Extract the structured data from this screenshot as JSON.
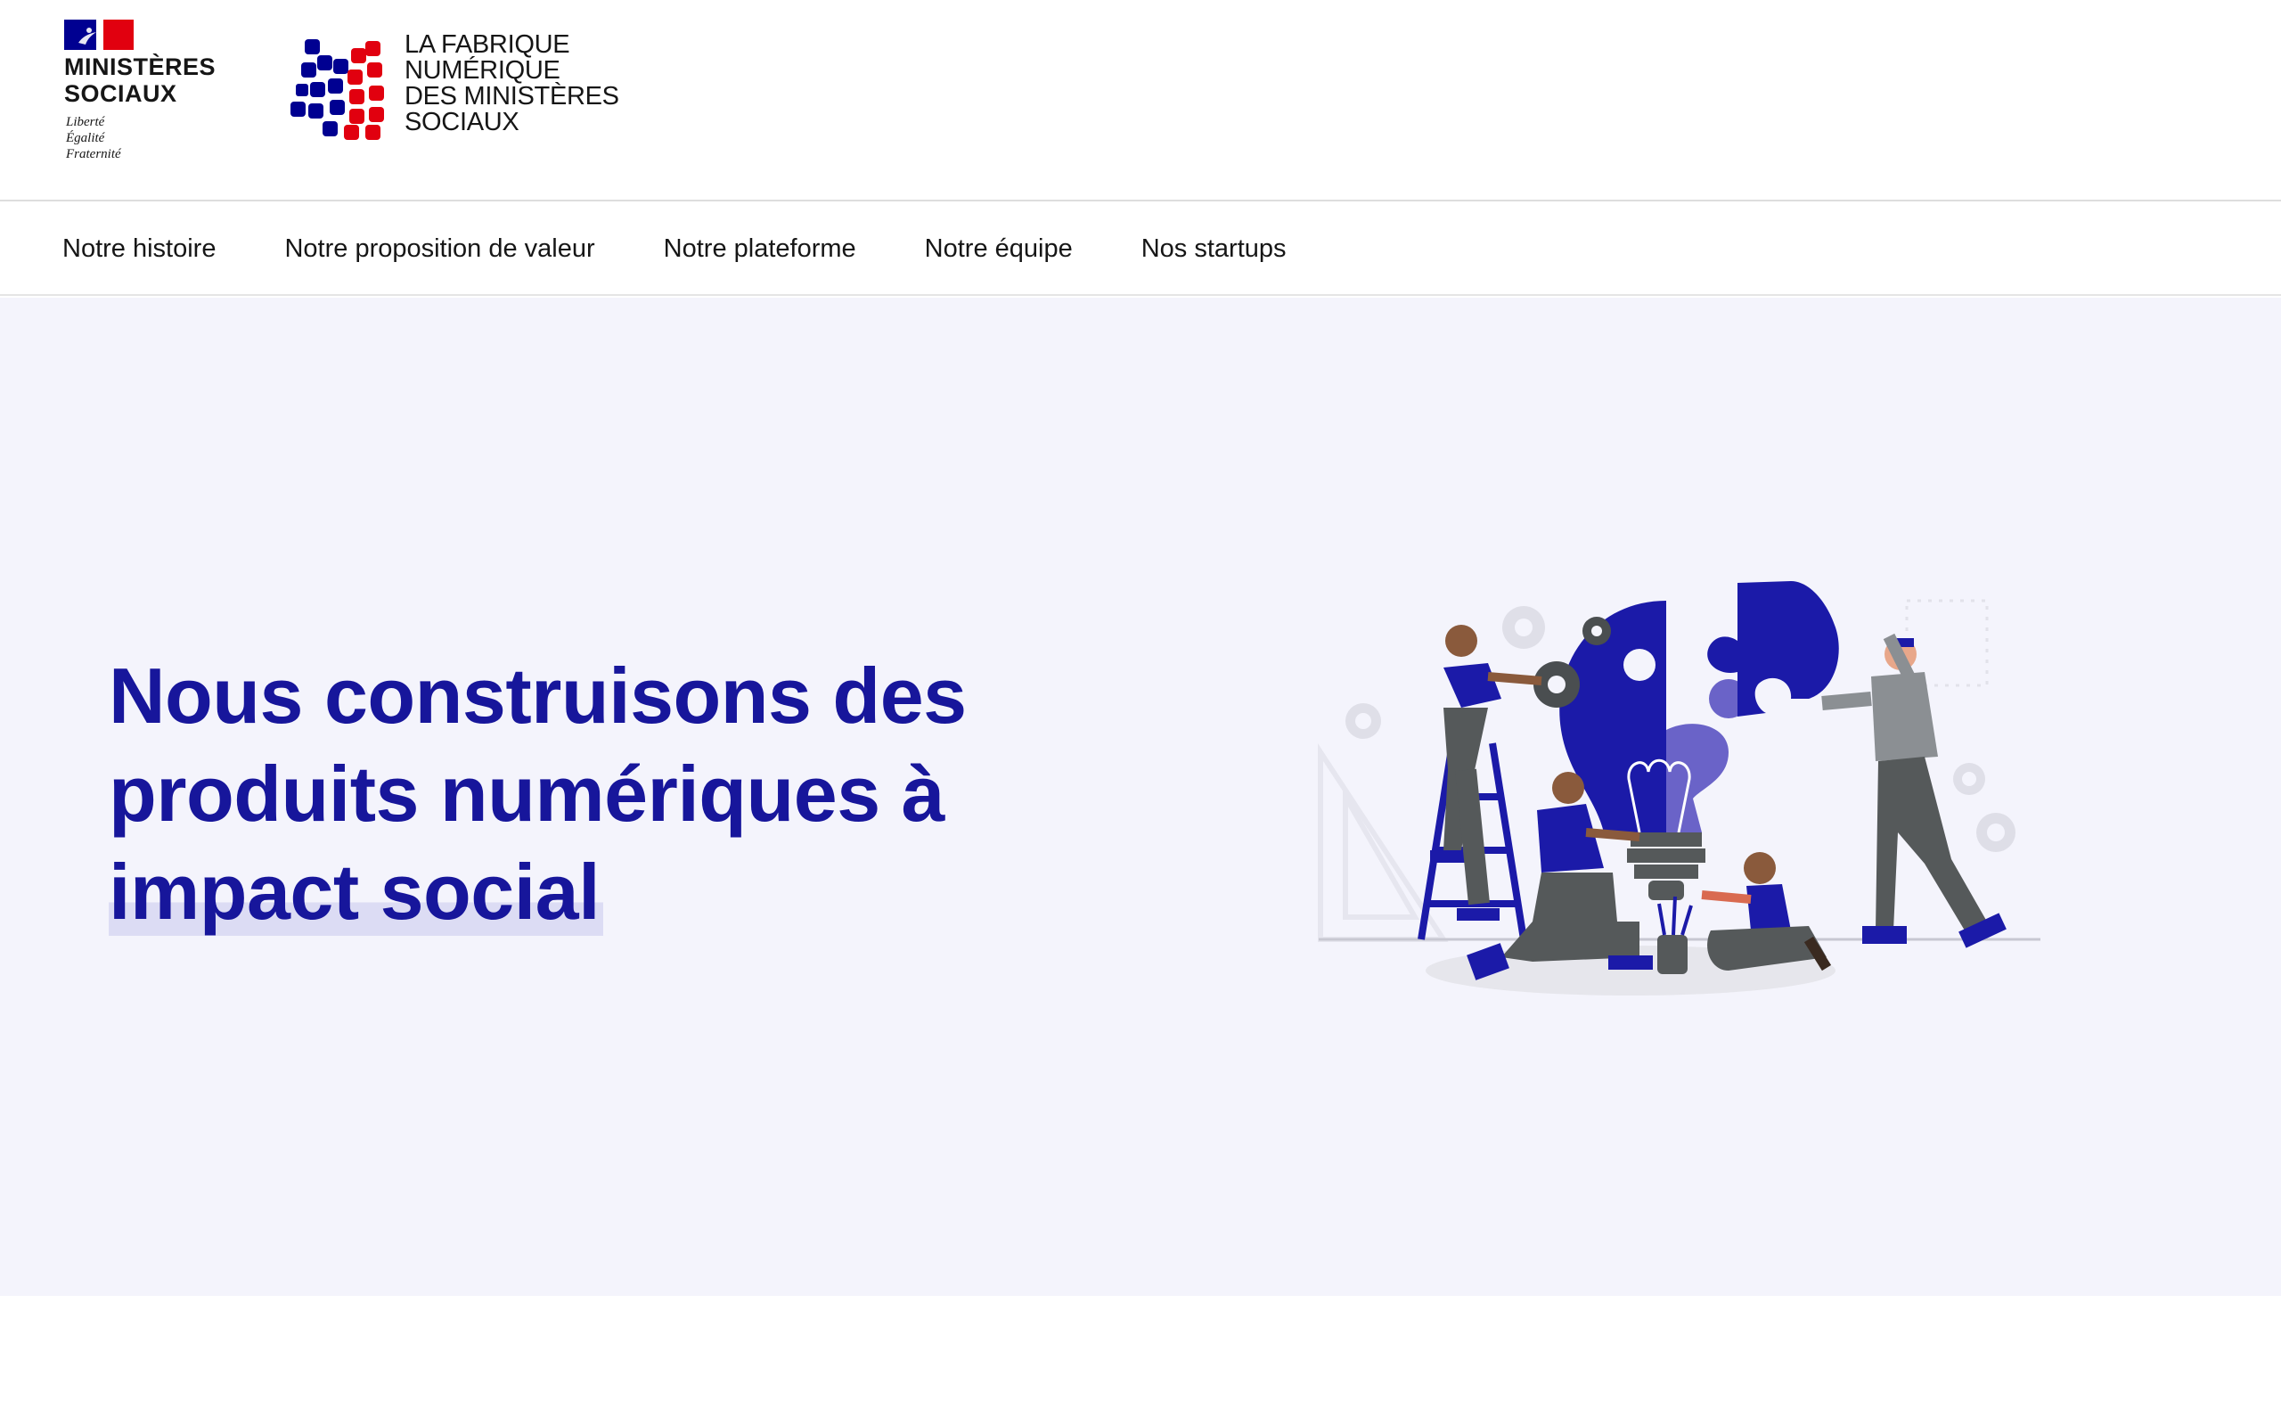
{
  "header": {
    "gov_logo": {
      "name": "MINISTÈRES\nSOCIAUX",
      "motto": "Liberté\nÉgalité\nFraternité"
    },
    "fabrique_logo": {
      "text": "LA FABRIQUE\nNUMÉRIQUE\nDES MINISTÈRES\nSOCIAUX",
      "colors": {
        "blue": "#000091",
        "red": "#e1000f"
      }
    }
  },
  "nav": {
    "items": [
      {
        "label": "Notre histoire"
      },
      {
        "label": "Notre proposition de valeur"
      },
      {
        "label": "Notre plateforme"
      },
      {
        "label": "Notre équipe"
      },
      {
        "label": "Nos startups"
      }
    ]
  },
  "hero": {
    "title_lines": [
      "Nous construisons des",
      "produits numériques à",
      "impact social"
    ],
    "illustration_icon": "team-building-lightbulb-puzzle-illustration",
    "colors": {
      "title": "#17169b",
      "background": "#f4f4fc",
      "highlight": "#dcdcf4"
    }
  }
}
